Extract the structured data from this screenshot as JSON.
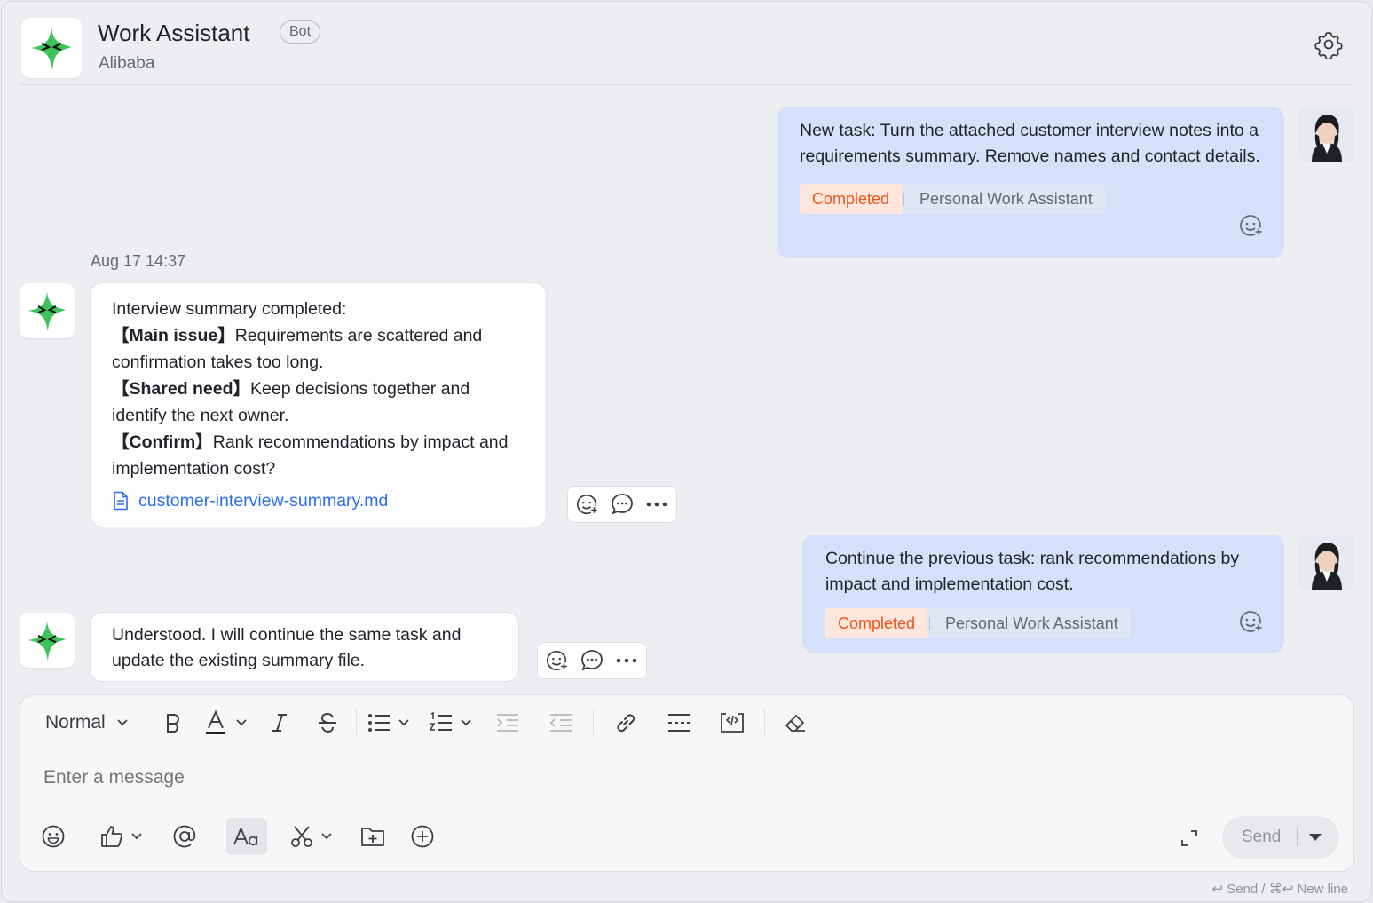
{
  "header": {
    "title": "Work Assistant",
    "badge": "Bot",
    "subtitle": "Alibaba"
  },
  "messages": {
    "user1": {
      "text": "New task: Turn the attached customer interview notes into a requirements summary. Remove names and contact details.",
      "status": "Completed",
      "assistant": "Personal Work Assistant"
    },
    "timestamp": "Aug 17 14:37",
    "bot1": {
      "intro": "Interview summary completed:",
      "items": [
        {
          "tag": "【Main issue】",
          "text": "Requirements are scattered and confirmation takes too long."
        },
        {
          "tag": "【Shared need】",
          "text": "Keep decisions together and identify the next owner."
        },
        {
          "tag": "【Confirm】",
          "text": "Rank recommendations by impact and implementation cost?"
        }
      ],
      "file": "customer-interview-summary.md"
    },
    "user2": {
      "text": "Continue the previous task: rank recommendations by impact and implementation cost.",
      "status": "Completed",
      "assistant": "Personal Work Assistant"
    },
    "bot2": {
      "text": "Understood. I will continue the same task and update the existing summary file."
    }
  },
  "composer": {
    "format": "Normal",
    "placeholder": "Enter a message",
    "send_label": "Send",
    "hint": "↩ Send / ⌘↩ New line"
  },
  "colors": {
    "user_bubble": "#d4e1f8",
    "status_text": "#f0541e",
    "link": "#2e6ef0",
    "bot_green": "#3cc35a"
  }
}
